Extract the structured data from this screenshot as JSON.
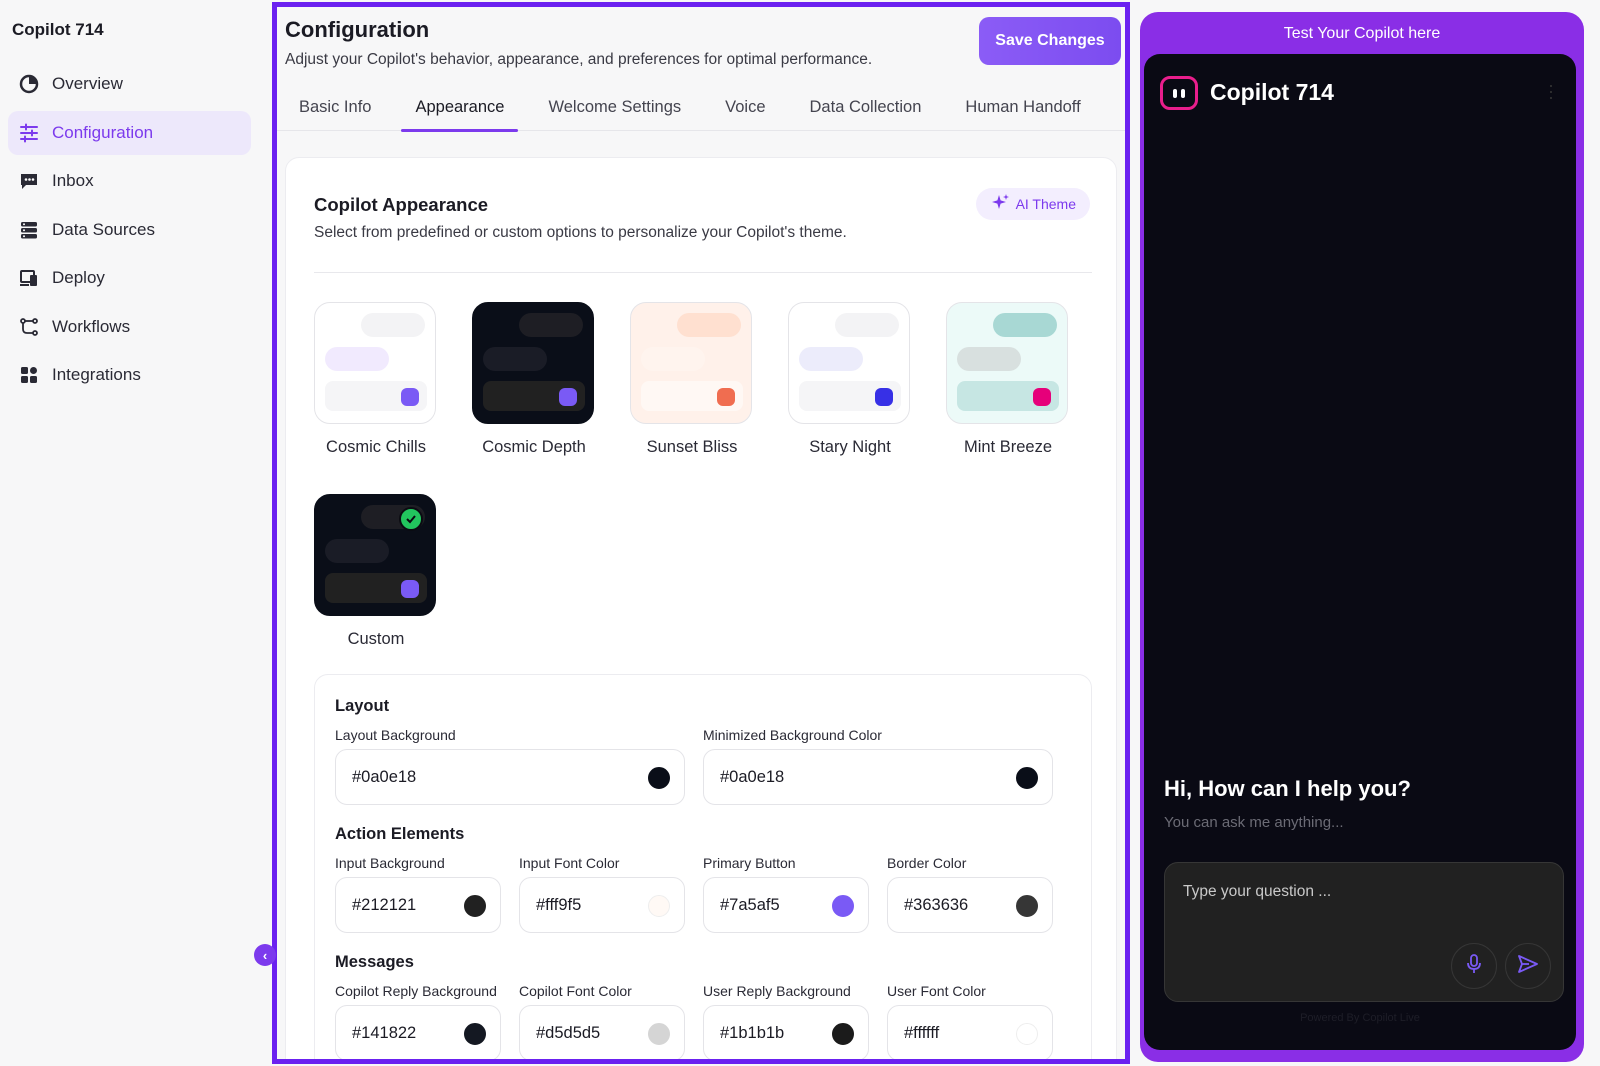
{
  "sidebar": {
    "brand": "Copilot 714",
    "items": [
      {
        "label": "Overview",
        "icon": "pie-chart-icon"
      },
      {
        "label": "Configuration",
        "icon": "sliders-icon",
        "active": true
      },
      {
        "label": "Inbox",
        "icon": "chat-icon"
      },
      {
        "label": "Data Sources",
        "icon": "database-icon"
      },
      {
        "label": "Deploy",
        "icon": "devices-icon"
      },
      {
        "label": "Workflows",
        "icon": "workflow-icon"
      },
      {
        "label": "Integrations",
        "icon": "grid-icon"
      }
    ]
  },
  "header": {
    "title": "Configuration",
    "subtitle": "Adjust your Copilot's behavior, appearance, and preferences for optimal performance.",
    "save_label": "Save Changes"
  },
  "tabs": [
    {
      "label": "Basic Info"
    },
    {
      "label": "Appearance",
      "active": true
    },
    {
      "label": "Welcome Settings"
    },
    {
      "label": "Voice"
    },
    {
      "label": "Data Collection"
    },
    {
      "label": "Human Handoff"
    }
  ],
  "appearance": {
    "title": "Copilot Appearance",
    "subtitle": "Select from predefined or custom options to personalize your Copilot's theme.",
    "ai_theme_label": "AI Theme",
    "themes": [
      {
        "name": "Cosmic Chills",
        "bg": "#ffffff",
        "b1": "#f3f3f5",
        "b2": "#f1eafe",
        "bar": "#f5f5f7",
        "dot": "#7a5af5"
      },
      {
        "name": "Cosmic Depth",
        "bg": "#0a0e18",
        "b1": "#1e1e24",
        "b2": "#1a1c26",
        "bar": "#212121",
        "dot": "#7a5af5"
      },
      {
        "name": "Sunset Bliss",
        "bg": "#fff1ea",
        "b1": "#ffe0d0",
        "b2": "#fff4ee",
        "bar": "#fff8f4",
        "dot": "#f06d50"
      },
      {
        "name": "Stary Night",
        "bg": "#ffffff",
        "b1": "#f3f3f5",
        "b2": "#ececfb",
        "bar": "#f5f5f7",
        "dot": "#3730e6"
      },
      {
        "name": "Mint Breeze",
        "bg": "#ecfaf8",
        "b1": "#a8d8d4",
        "b2": "#d8e0df",
        "bar": "#c6e6e3",
        "dot": "#e6007a"
      },
      {
        "name": "Custom",
        "bg": "#0a0e18",
        "b1": "#1e1e24",
        "b2": "#1a1c26",
        "bar": "#212121",
        "dot": "#7a5af5",
        "selected": true
      }
    ]
  },
  "layout": {
    "title": "Layout",
    "layout_bg_label": "Layout Background",
    "layout_bg_value": "#0a0e18",
    "min_bg_label": "Minimized Background Color",
    "min_bg_value": "#0a0e18"
  },
  "action": {
    "title": "Action Elements",
    "fields": [
      {
        "label": "Input Background",
        "value": "#212121"
      },
      {
        "label": "Input Font Color",
        "value": "#fff9f5"
      },
      {
        "label": "Primary Button",
        "value": "#7a5af5"
      },
      {
        "label": "Border Color",
        "value": "#363636"
      }
    ]
  },
  "messages": {
    "title": "Messages",
    "fields": [
      {
        "label": "Copilot Reply Background",
        "value": "#141822"
      },
      {
        "label": "Copilot Font Color",
        "value": "#d5d5d5"
      },
      {
        "label": "User Reply Background",
        "value": "#1b1b1b"
      },
      {
        "label": "User Font Color",
        "value": "#ffffff"
      }
    ]
  },
  "preview": {
    "header": "Test Your Copilot here",
    "name": "Copilot 714",
    "greeting": "Hi, How can I help you?",
    "greeting_sub": "You can ask me anything...",
    "input_placeholder": "Type your question ...",
    "powered": "Powered By Copilot Live"
  },
  "colors": {
    "accent": "#7c3aed",
    "frame": "#6b21f0",
    "preview_frame": "#8a2ee6"
  }
}
